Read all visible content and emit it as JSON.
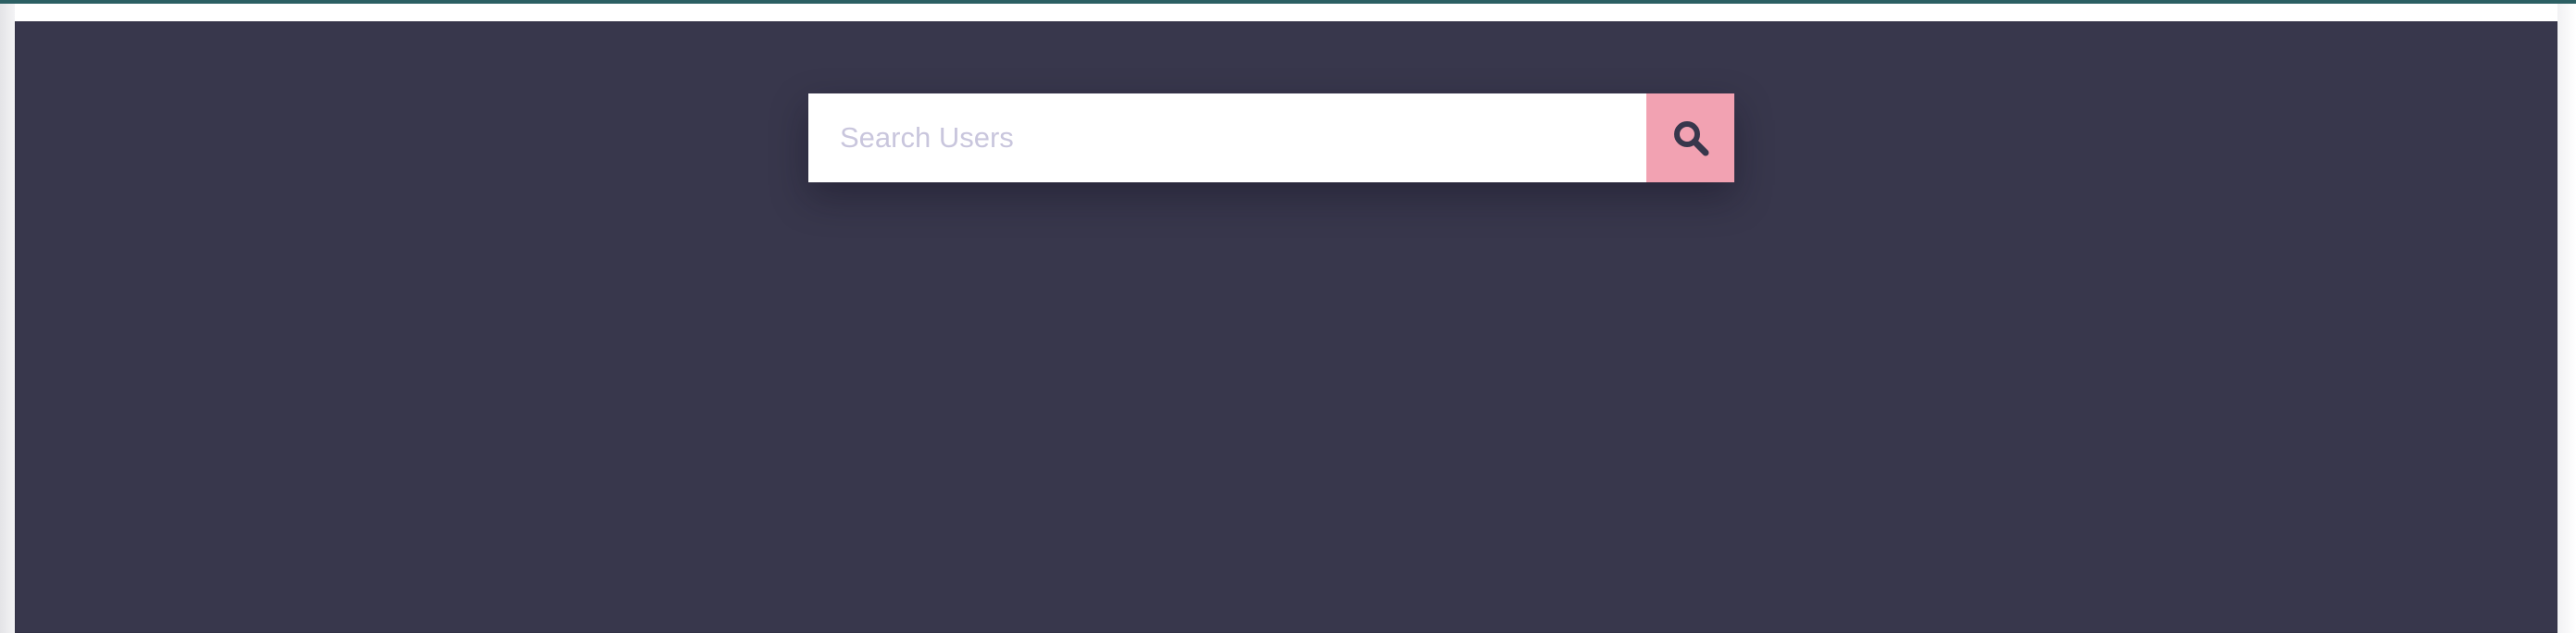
{
  "search": {
    "placeholder": "Search Users",
    "button_icon": "search-icon"
  },
  "colors": {
    "background": "#38374c",
    "input_background": "#ffffff",
    "placeholder": "#c9c6dd",
    "button_accent": "#f2a2b2",
    "icon": "#38374c",
    "top_accent": "#2c5f63"
  }
}
